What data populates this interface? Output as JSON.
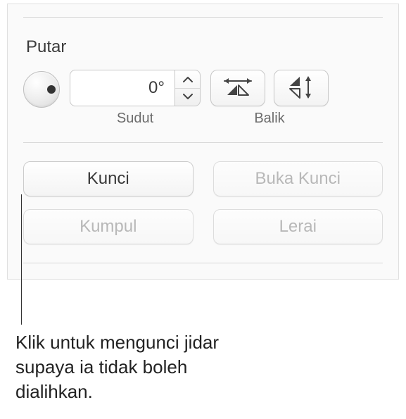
{
  "rotate": {
    "title": "Putar",
    "angle_value": "0°",
    "angle_label": "Sudut",
    "flip_label": "Balik"
  },
  "buttons": {
    "lock": "Kunci",
    "unlock": "Buka Kunci",
    "group": "Kumpul",
    "ungroup": "Lerai"
  },
  "callout": {
    "text": "Klik untuk mengunci jidar supaya ia tidak boleh dialihkan."
  },
  "icons": {
    "flip_h": "flip-horizontal-icon",
    "flip_v": "flip-vertical-icon",
    "step_up": "chevron-up-icon",
    "step_down": "chevron-down-icon"
  }
}
